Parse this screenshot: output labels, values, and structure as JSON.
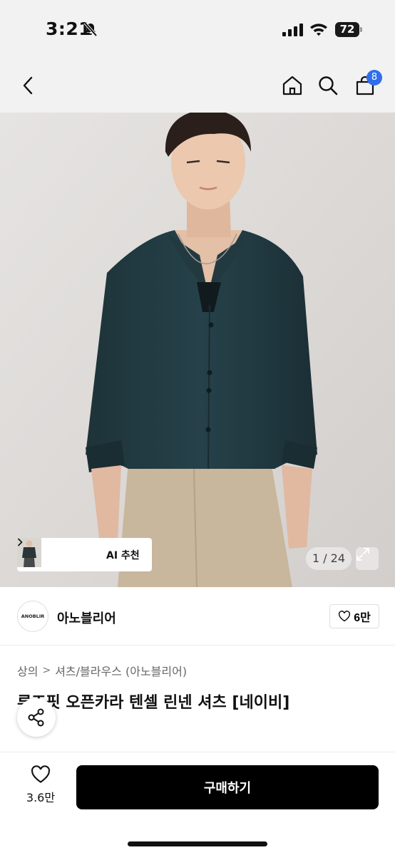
{
  "status_bar": {
    "time": "3:21",
    "battery": "72",
    "icons": [
      "bell-slash-icon",
      "signal-icon",
      "wifi-icon",
      "battery-icon"
    ]
  },
  "header": {
    "icons": [
      "chevron-left-icon",
      "home-icon",
      "search-icon",
      "cart-icon"
    ],
    "cart_badge": "8",
    "accent_color": "#2f6fed"
  },
  "gallery": {
    "ai_label": "AI 추천",
    "page_counter": "1 / 24",
    "expand_icon": "expand-icon"
  },
  "brand": {
    "logo_text": "ANOBLIR",
    "name": "아노블리어",
    "likes": "6만"
  },
  "product": {
    "breadcrumb": [
      "상의",
      "셔츠/블라우스 (아노블리어)"
    ],
    "title": "루즈핏 오픈카라 텐셀 린넨 셔츠 [네이비]"
  },
  "bottom_bar": {
    "wish_count": "3.6만",
    "buy_label": "구매하기"
  }
}
